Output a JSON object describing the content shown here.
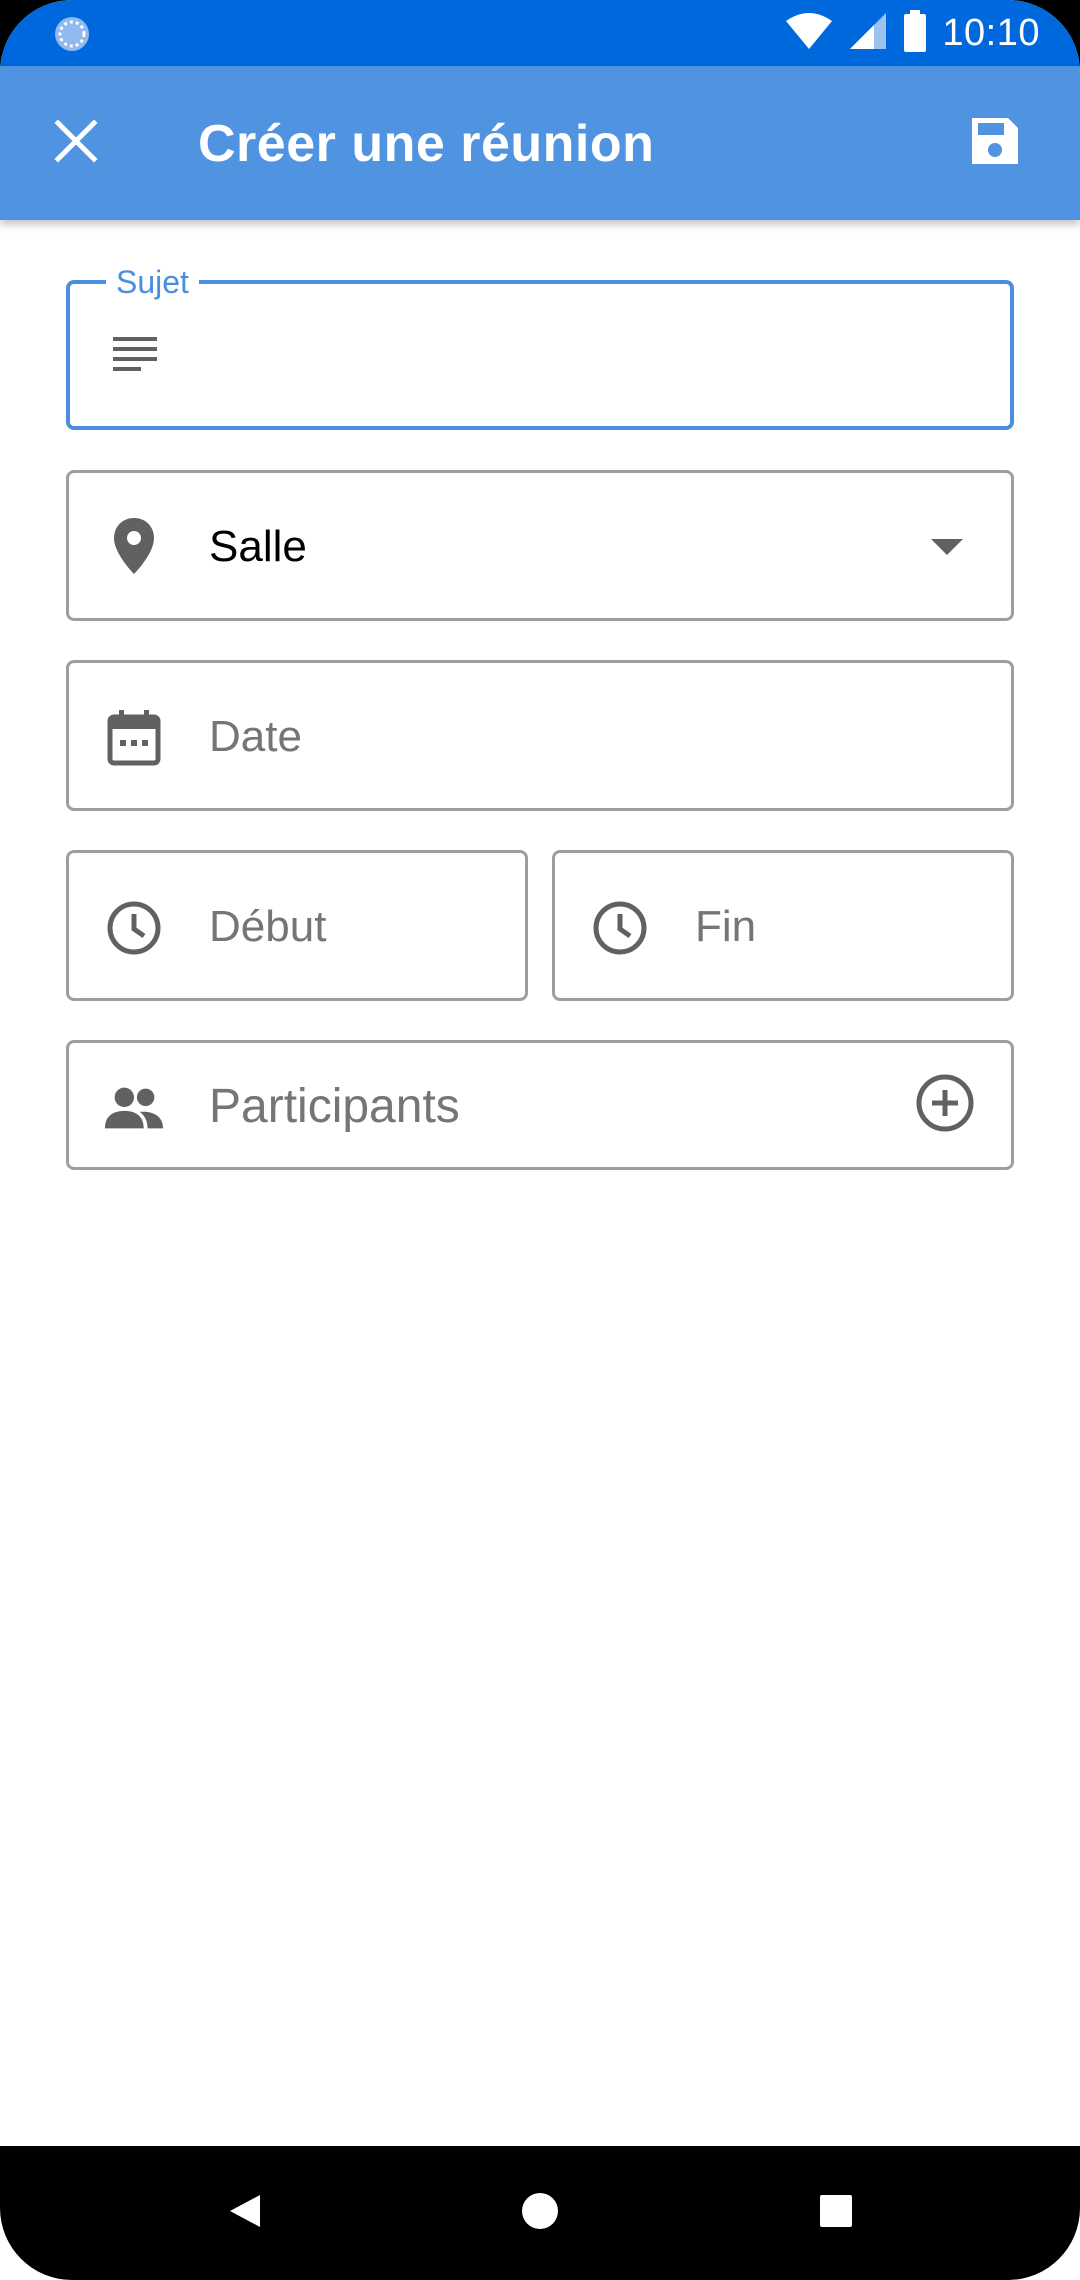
{
  "status_bar": {
    "time": "10:10",
    "background_color": "#0068DD",
    "icons": [
      "app-notification-icon",
      "wifi-icon",
      "signal-icon",
      "battery-icon"
    ]
  },
  "app_bar": {
    "title": "Créer une réunion",
    "close_icon": "close-icon",
    "save_icon": "save-icon",
    "background_color": "#5093E0"
  },
  "form": {
    "subject": {
      "label": "Sujet",
      "value": "",
      "icon": "subject-icon",
      "accent_color": "#4A8FDF"
    },
    "room": {
      "selected": "Salle",
      "icon": "location-pin-icon"
    },
    "date": {
      "placeholder": "Date",
      "icon": "calendar-icon"
    },
    "start": {
      "placeholder": "Début",
      "icon": "clock-icon"
    },
    "end": {
      "placeholder": "Fin",
      "icon": "clock-icon"
    },
    "participants": {
      "placeholder": "Participants",
      "icon": "people-icon",
      "add_icon": "add-circle-icon"
    }
  },
  "nav_bar": {
    "buttons": [
      "back-icon",
      "home-icon",
      "recents-icon"
    ]
  }
}
